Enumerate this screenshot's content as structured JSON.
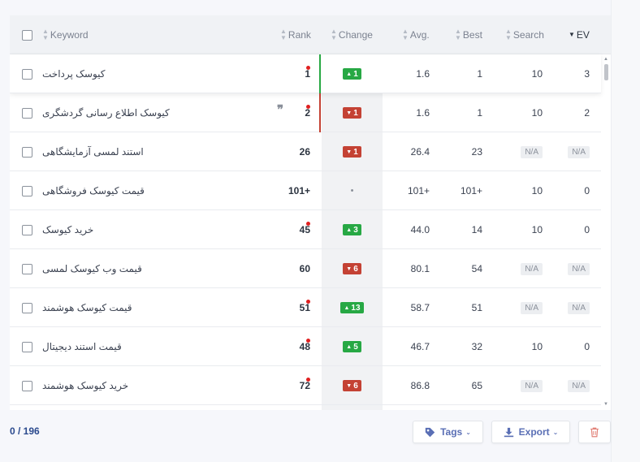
{
  "header": {
    "keyword": "Keyword",
    "rank": "Rank",
    "change": "Change",
    "avg": "Avg.",
    "best": "Best",
    "search": "Search",
    "ev": "EV"
  },
  "rows": [
    {
      "keyword": "کیوسک پرداخت",
      "rank": "1",
      "dot": true,
      "quote": false,
      "change": "1",
      "dir": "up",
      "avg": "1.6",
      "best": "1",
      "search": "10",
      "ev": "3",
      "bar": "green",
      "highlight": true
    },
    {
      "keyword": "کیوسک اطلاع رسانی گردشگری",
      "rank": "2",
      "dot": true,
      "quote": true,
      "change": "1",
      "dir": "down",
      "avg": "1.6",
      "best": "1",
      "search": "10",
      "ev": "2",
      "bar": "red",
      "highlight": false
    },
    {
      "keyword": "استند لمسی آزمایشگاهی",
      "rank": "26",
      "dot": false,
      "quote": false,
      "change": "1",
      "dir": "down",
      "avg": "26.4",
      "best": "23",
      "search": "N/A",
      "ev": "N/A"
    },
    {
      "keyword": "قیمت کیوسک فروشگاهی",
      "rank": "101+",
      "dot": false,
      "quote": false,
      "change": "•",
      "dir": "none",
      "avg": "101+",
      "best": "101+",
      "search": "10",
      "ev": "0"
    },
    {
      "keyword": "خرید کیوسک",
      "rank": "45",
      "dot": true,
      "quote": false,
      "change": "3",
      "dir": "up",
      "avg": "44.0",
      "best": "14",
      "search": "10",
      "ev": "0"
    },
    {
      "keyword": "قیمت وب کیوسک لمسی",
      "rank": "60",
      "dot": false,
      "quote": false,
      "change": "6",
      "dir": "down",
      "avg": "80.1",
      "best": "54",
      "search": "N/A",
      "ev": "N/A"
    },
    {
      "keyword": "قیمت کیوسک هوشمند",
      "rank": "51",
      "dot": true,
      "quote": false,
      "change": "13",
      "dir": "up",
      "avg": "58.7",
      "best": "51",
      "search": "N/A",
      "ev": "N/A"
    },
    {
      "keyword": "قیمت استند دیجیتال",
      "rank": "48",
      "dot": true,
      "quote": false,
      "change": "5",
      "dir": "up",
      "avg": "46.7",
      "best": "32",
      "search": "10",
      "ev": "0"
    },
    {
      "keyword": "خرید کیوسک هوشمند",
      "rank": "72",
      "dot": true,
      "quote": false,
      "change": "6",
      "dir": "down",
      "avg": "86.8",
      "best": "65",
      "search": "N/A",
      "ev": "N/A"
    }
  ],
  "footer": {
    "count": "0 / 196",
    "tags_label": "Tags",
    "export_label": "Export"
  },
  "colors": {
    "up": "#27a844",
    "down": "#c44234",
    "accent": "#5a6fb5",
    "delete": "#e2837a"
  },
  "icons": [
    "sort-icon",
    "tag-icon",
    "download-icon",
    "trash-icon",
    "chevron-down-icon"
  ]
}
